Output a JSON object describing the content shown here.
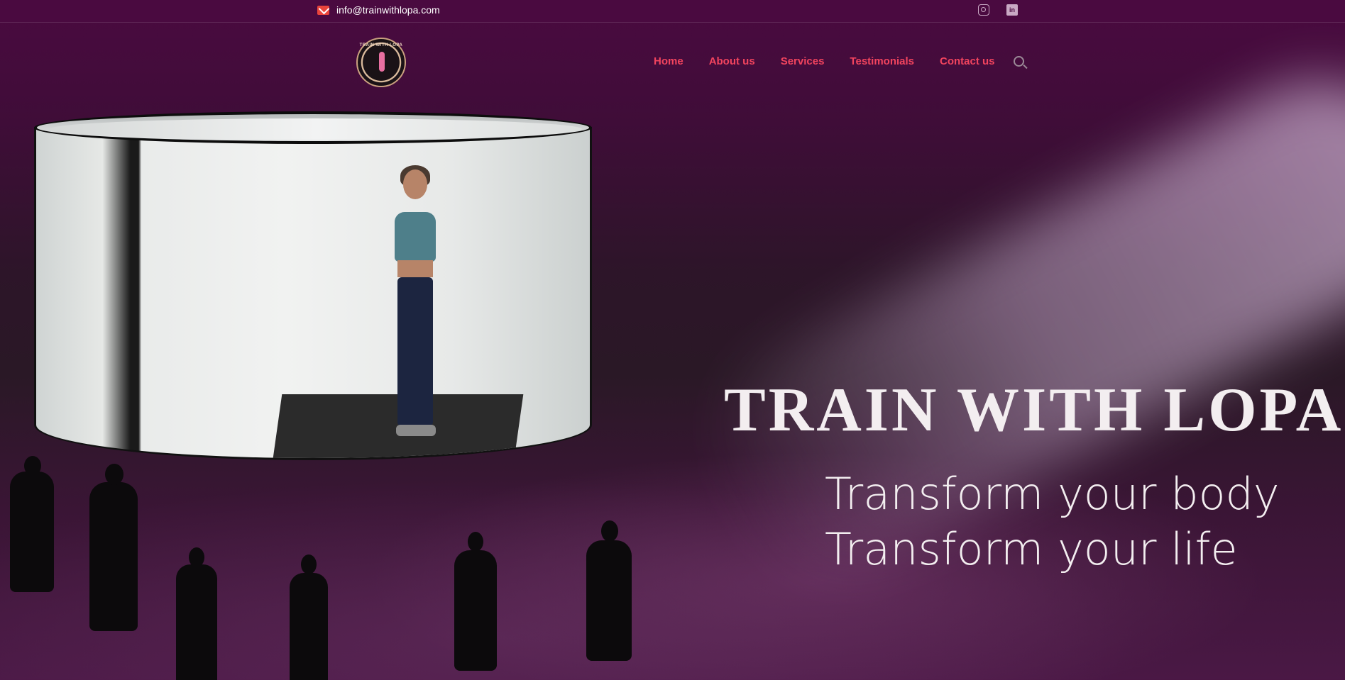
{
  "topbar": {
    "email": "info@trainwithlopa.com",
    "social": [
      {
        "icon": "instagram-icon"
      },
      {
        "icon": "linkedin-icon"
      }
    ]
  },
  "logo": {
    "text": "TRAIN WITH LOPA"
  },
  "nav": {
    "items": [
      {
        "label": "Home"
      },
      {
        "label": "About us"
      },
      {
        "label": "Services"
      },
      {
        "label": "Testimonials"
      },
      {
        "label": "Contact us"
      }
    ],
    "search_icon": "search-icon"
  },
  "hero": {
    "title": "TRAIN WITH LOPA",
    "subtitle_line1": "Transform your body",
    "subtitle_line2": "Transform your life"
  },
  "colors": {
    "nav_link": "#f2445e",
    "background": "#4a0a40",
    "email_icon": "#e8453c"
  }
}
